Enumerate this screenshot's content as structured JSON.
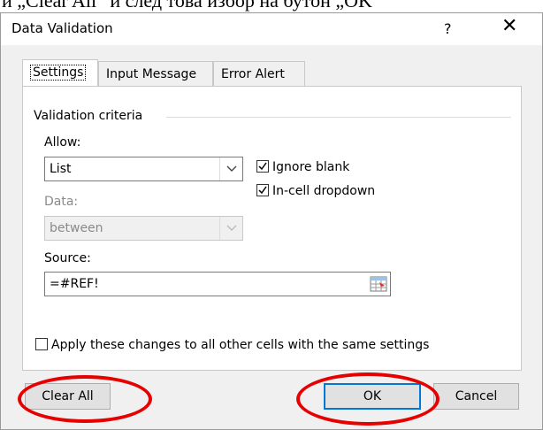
{
  "top_text": "и „Clear All“ и след това избор на бутон „OK“",
  "dialog": {
    "title": "Data Validation",
    "help_label": "?",
    "close_label": "✕"
  },
  "tabs": [
    {
      "label": "Settings",
      "active": true
    },
    {
      "label": "Input Message",
      "active": false
    },
    {
      "label": "Error Alert",
      "active": false
    }
  ],
  "settings": {
    "group_title": "Validation criteria",
    "allow_label": "Allow:",
    "allow_value": "List",
    "data_label": "Data:",
    "data_value": "between",
    "ignore_blank_label": "Ignore blank",
    "ignore_blank_checked": true,
    "in_cell_dropdown_label": "In-cell dropdown",
    "in_cell_dropdown_checked": true,
    "source_label": "Source:",
    "source_value": "=#REF!",
    "apply_all_label": "Apply these changes to all other cells with the same settings",
    "apply_all_checked": false
  },
  "buttons": {
    "clear_all": "Clear All",
    "ok": "OK",
    "cancel": "Cancel"
  },
  "colors": {
    "highlight": "#e60000",
    "focus": "#0078d7"
  },
  "icons": [
    "chevron-down-icon",
    "checkmark-icon",
    "range-select-icon",
    "close-icon"
  ]
}
